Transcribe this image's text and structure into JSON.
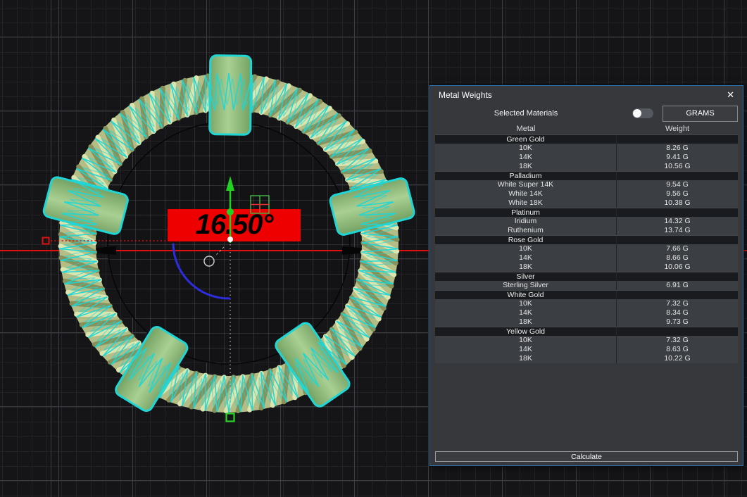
{
  "viewport": {
    "angle_label": "16.50°",
    "toggle_note": "ring model selected (cyan highlight), top view with grid",
    "colors": {
      "accent_cyan": "#1fd6d6",
      "rope_base": "#b3bd85",
      "rope_light": "#dde5ae",
      "rope_dark": "#879159",
      "station_light": "#a9d092",
      "station_dark": "#79a768",
      "axis_red": "#e01010",
      "gizmo_green": "#23d123",
      "arc_blue": "#2d2de0",
      "label_bg": "#ee0000"
    }
  },
  "panel": {
    "title": "Metal Weights",
    "close_icon": "✕",
    "selected_materials_label": "Selected Materials",
    "selected_materials_toggle": "off",
    "units_button": "GRAMS",
    "columns": {
      "metal": "Metal",
      "weight": "Weight"
    },
    "calculate_button": "Calculate",
    "groups": [
      {
        "name": "Green Gold",
        "rows": [
          {
            "label": "10K",
            "value": "8.26 G"
          },
          {
            "label": "14K",
            "value": "9.41 G"
          },
          {
            "label": "18K",
            "value": "10.56 G"
          }
        ]
      },
      {
        "name": "Palladium",
        "rows": [
          {
            "label": "White Super 14K",
            "value": "9.54 G"
          },
          {
            "label": "White 14K",
            "value": "9.56 G"
          },
          {
            "label": "White 18K",
            "value": "10.38 G"
          }
        ]
      },
      {
        "name": "Platinum",
        "rows": [
          {
            "label": "Iridium",
            "value": "14.32 G"
          },
          {
            "label": "Ruthenium",
            "value": "13.74 G"
          }
        ]
      },
      {
        "name": "Rose Gold",
        "rows": [
          {
            "label": "10K",
            "value": "7.66 G"
          },
          {
            "label": "14K",
            "value": "8.66 G"
          },
          {
            "label": "18K",
            "value": "10.06 G"
          }
        ]
      },
      {
        "name": "Silver",
        "rows": [
          {
            "label": "Sterling Silver",
            "value": "6.91 G"
          }
        ]
      },
      {
        "name": "White Gold",
        "rows": [
          {
            "label": "10K",
            "value": "7.32 G"
          },
          {
            "label": "14K",
            "value": "8.34 G"
          },
          {
            "label": "18K",
            "value": "9.73 G"
          }
        ]
      },
      {
        "name": "Yellow Gold",
        "rows": [
          {
            "label": "10K",
            "value": "7.32 G"
          },
          {
            "label": "14K",
            "value": "8.63 G"
          },
          {
            "label": "18K",
            "value": "10.22 G"
          }
        ]
      }
    ]
  }
}
